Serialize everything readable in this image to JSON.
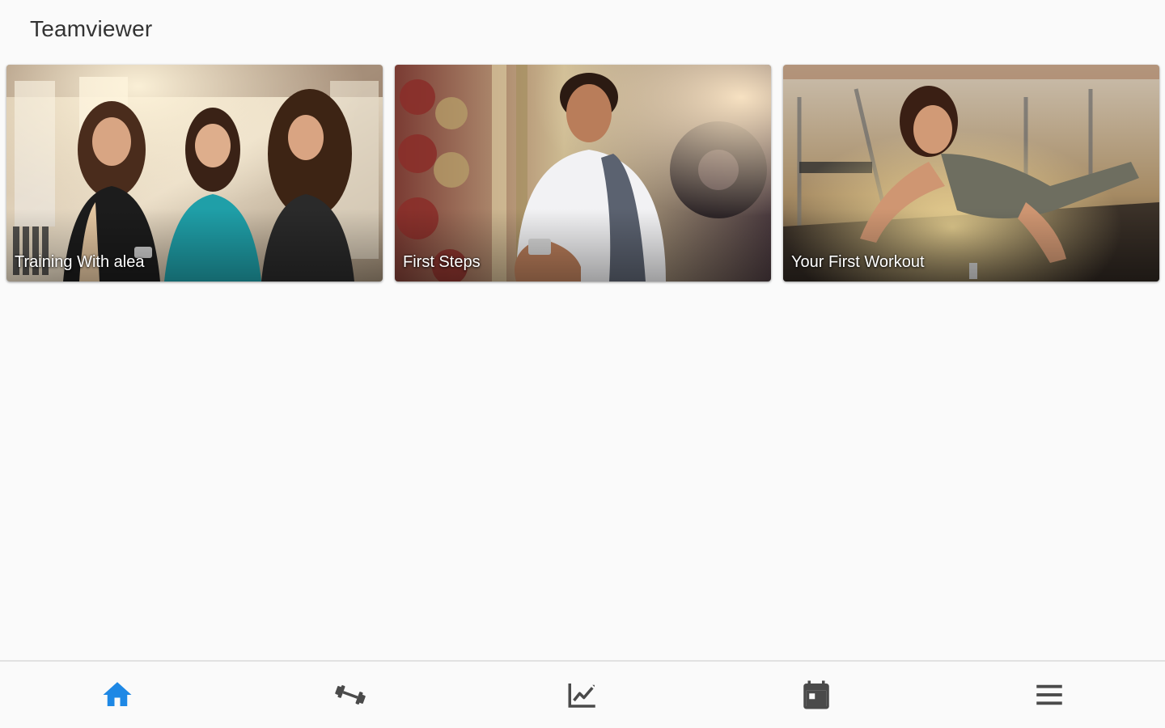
{
  "header": {
    "title": "Teamviewer"
  },
  "cards": [
    {
      "label": "Training With alea",
      "scene": "three-women-gym"
    },
    {
      "label": "First Steps",
      "scene": "man-phone-gym"
    },
    {
      "label": "Your First Workout",
      "scene": "woman-pushup-gym"
    }
  ],
  "bottom_nav": {
    "items": [
      {
        "icon": "home-icon",
        "active": true
      },
      {
        "icon": "dumbbell-icon",
        "active": false
      },
      {
        "icon": "chart-line-icon",
        "active": false
      },
      {
        "icon": "calendar-icon",
        "active": false
      },
      {
        "icon": "menu-icon",
        "active": false
      }
    ],
    "active_color": "#1e88e5",
    "inactive_color": "#4a4a4a"
  }
}
